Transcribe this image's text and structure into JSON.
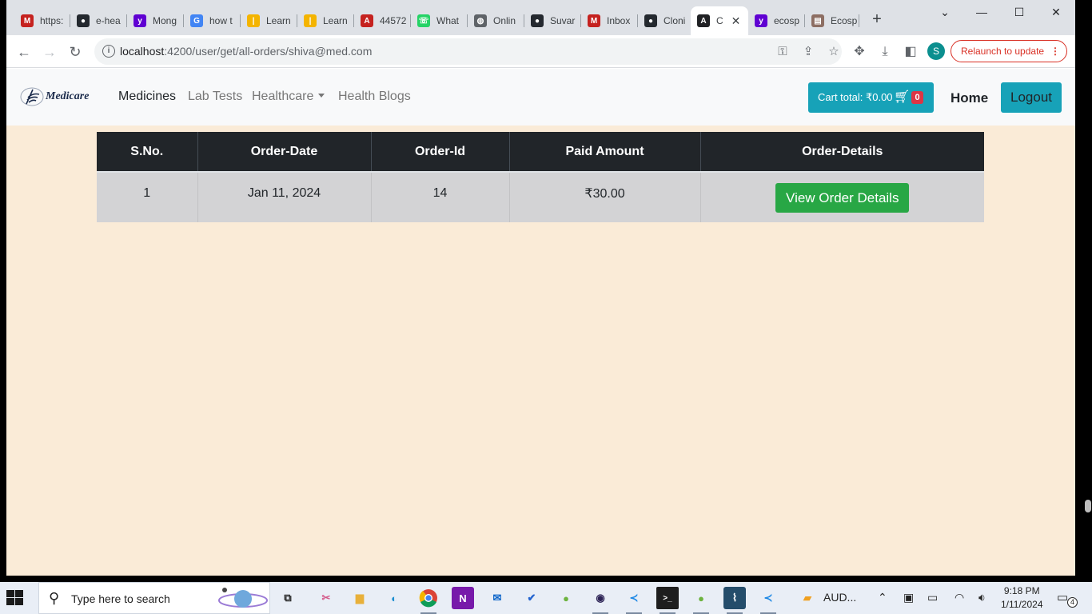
{
  "browser": {
    "tabs": [
      {
        "label": "https:",
        "favicon": "gmail-icon",
        "color": "#c5221f",
        "glyph": "M"
      },
      {
        "label": "e-hea",
        "favicon": "github-icon",
        "color": "#24292f",
        "glyph": "●"
      },
      {
        "label": "Mong",
        "favicon": "yahoo-icon",
        "color": "#6001d2",
        "glyph": "y"
      },
      {
        "label": "how t",
        "favicon": "google-icon",
        "color": "#4285f4",
        "glyph": "G"
      },
      {
        "label": "Learn",
        "favicon": "bars-icon",
        "color": "#f4b400",
        "glyph": "|"
      },
      {
        "label": "Learn",
        "favicon": "bars-icon",
        "color": "#f4b400",
        "glyph": "|"
      },
      {
        "label": "44572",
        "favicon": "pdf-icon",
        "color": "#c5221f",
        "glyph": "A"
      },
      {
        "label": "What",
        "favicon": "whatsapp-icon",
        "color": "#25d366",
        "glyph": "☏"
      },
      {
        "label": "Onlin",
        "favicon": "globe-icon",
        "color": "#5f6368",
        "glyph": "◍"
      },
      {
        "label": "Suvar",
        "favicon": "github-icon",
        "color": "#24292f",
        "glyph": "●"
      },
      {
        "label": "Inbox",
        "favicon": "gmail-icon",
        "color": "#c5221f",
        "glyph": "M"
      },
      {
        "label": "Cloni",
        "favicon": "github-icon",
        "color": "#24292f",
        "glyph": "●"
      },
      {
        "label": "C",
        "favicon": "angular-icon",
        "color": "#202124",
        "glyph": "A",
        "active": true
      },
      {
        "label": "ecosp",
        "favicon": "yahoo-icon",
        "color": "#6001d2",
        "glyph": "y"
      },
      {
        "label": "Ecosp",
        "favicon": "news-icon",
        "color": "#8d6e63",
        "glyph": "▤"
      }
    ],
    "url_host": "localhost",
    "url_rest": ":4200/user/get/all-orders/shiva@med.com",
    "profile_initial": "S",
    "relaunch_label": "Relaunch to update"
  },
  "app": {
    "brand": "Medicare",
    "nav": {
      "medicines": "Medicines",
      "lab_tests": "Lab Tests",
      "healthcare": "Healthcare",
      "health_blogs": "Health Blogs"
    },
    "cart_label": "Cart total: ₹0.00",
    "cart_count": "0",
    "home": "Home",
    "logout": "Logout"
  },
  "orders": {
    "columns": [
      "S.No.",
      "Order-Date",
      "Order-Id",
      "Paid Amount",
      "Order-Details"
    ],
    "rows": [
      {
        "sno": "1",
        "date": "Jan 11, 2024",
        "id": "14",
        "amount": "₹30.00",
        "action": "View Order Details"
      }
    ]
  },
  "taskbar": {
    "search_placeholder": "Type here to search",
    "audio_label": "AUD...",
    "time": "9:18 PM",
    "date": "1/11/2024",
    "notification_count": "4"
  },
  "colors": {
    "page_bg": "#faebd7",
    "table_header": "#212529",
    "info_button": "#17a2b8",
    "success_button": "#28a745",
    "badge": "#dc3545"
  }
}
